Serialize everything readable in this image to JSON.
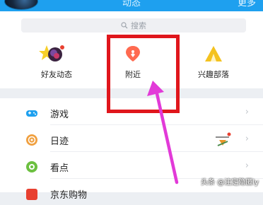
{
  "header": {
    "title": "动态",
    "more": "更多"
  },
  "search": {
    "placeholder": "搜索"
  },
  "grid": [
    {
      "label": "好友动态",
      "icon": "star-avatar-icon"
    },
    {
      "label": "附近",
      "icon": "location-pin-icon"
    },
    {
      "label": "兴趣部落",
      "icon": "tribe-tent-icon"
    }
  ],
  "list": [
    {
      "label": "游戏",
      "icon": "gamepad-icon"
    },
    {
      "label": "日迹",
      "icon": "daily-trace-icon"
    },
    {
      "label": "看点",
      "icon": "eye-icon"
    },
    {
      "label": "京东购物",
      "icon": "shopping-icon"
    }
  ],
  "watermark": "头条 @注定隐匿ly",
  "colors": {
    "header": "#1ea0ef",
    "highlight_box": "#e0161c",
    "arrow": "#e23ad8",
    "nearby_pin": "#ff6a50",
    "tribe": "#f4c21f",
    "game": "#1ea0ef",
    "daily": "#f0a040",
    "eye": "#6cc040",
    "shop": "#e84030"
  }
}
